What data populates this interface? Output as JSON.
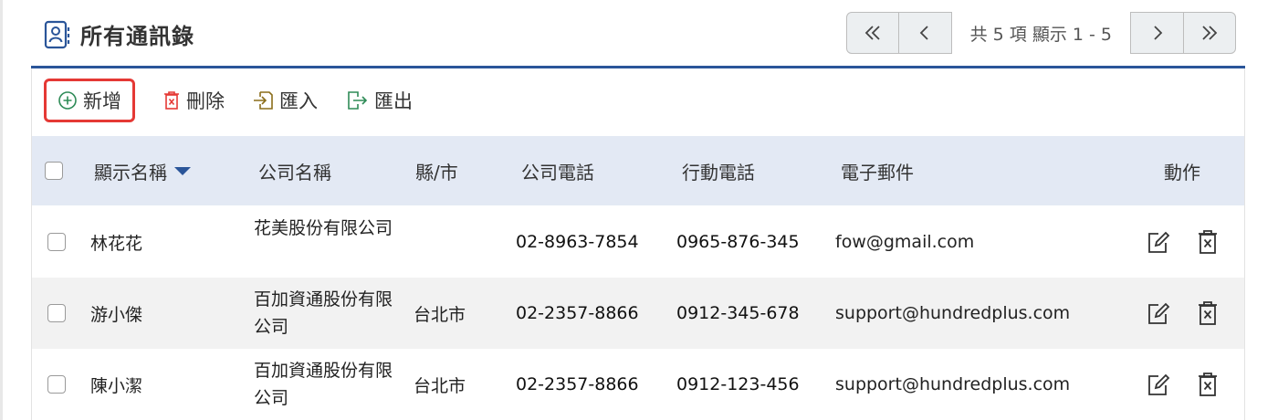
{
  "header": {
    "title": "所有通訊錄",
    "pager_text": "共 5 項 顯示 1 - 5"
  },
  "toolbar": {
    "add_label": "新增",
    "delete_label": "刪除",
    "import_label": "匯入",
    "export_label": "匯出"
  },
  "table": {
    "columns": [
      "顯示名稱",
      "公司名稱",
      "縣/市",
      "公司電話",
      "行動電話",
      "電子郵件",
      "動作"
    ],
    "rows": [
      {
        "name": "林花花",
        "company": "花美股份有限公司",
        "city": "",
        "office_phone": "02-8963-7854",
        "mobile": "0965-876-345",
        "email": "fow@gmail.com"
      },
      {
        "name": "游小傑",
        "company": "百加資通股份有限公司",
        "city": "台北市",
        "office_phone": "02-2357-8866",
        "mobile": "0912-345-678",
        "email": "support@hundredplus.com"
      },
      {
        "name": "陳小潔",
        "company": "百加資通股份有限公司",
        "city": "台北市",
        "office_phone": "02-2357-8866",
        "mobile": "0912-123-456",
        "email": "support@hundredplus.com"
      }
    ]
  },
  "colors": {
    "accent": "#2a5599",
    "header_bg": "#e3e9f4",
    "add_highlight": "#e53935",
    "delete_icon": "#e53935",
    "add_icon": "#2e8b57",
    "import_icon": "#8a6d1a",
    "export_icon": "#2e8b57"
  },
  "icons": {
    "title": "contacts-book-icon",
    "first": "double-chevron-left-icon",
    "prev": "chevron-left-icon",
    "next": "chevron-right-icon",
    "last": "double-chevron-right-icon",
    "sort": "sort-down-icon",
    "edit": "edit-icon",
    "delete_row": "trash-icon"
  }
}
